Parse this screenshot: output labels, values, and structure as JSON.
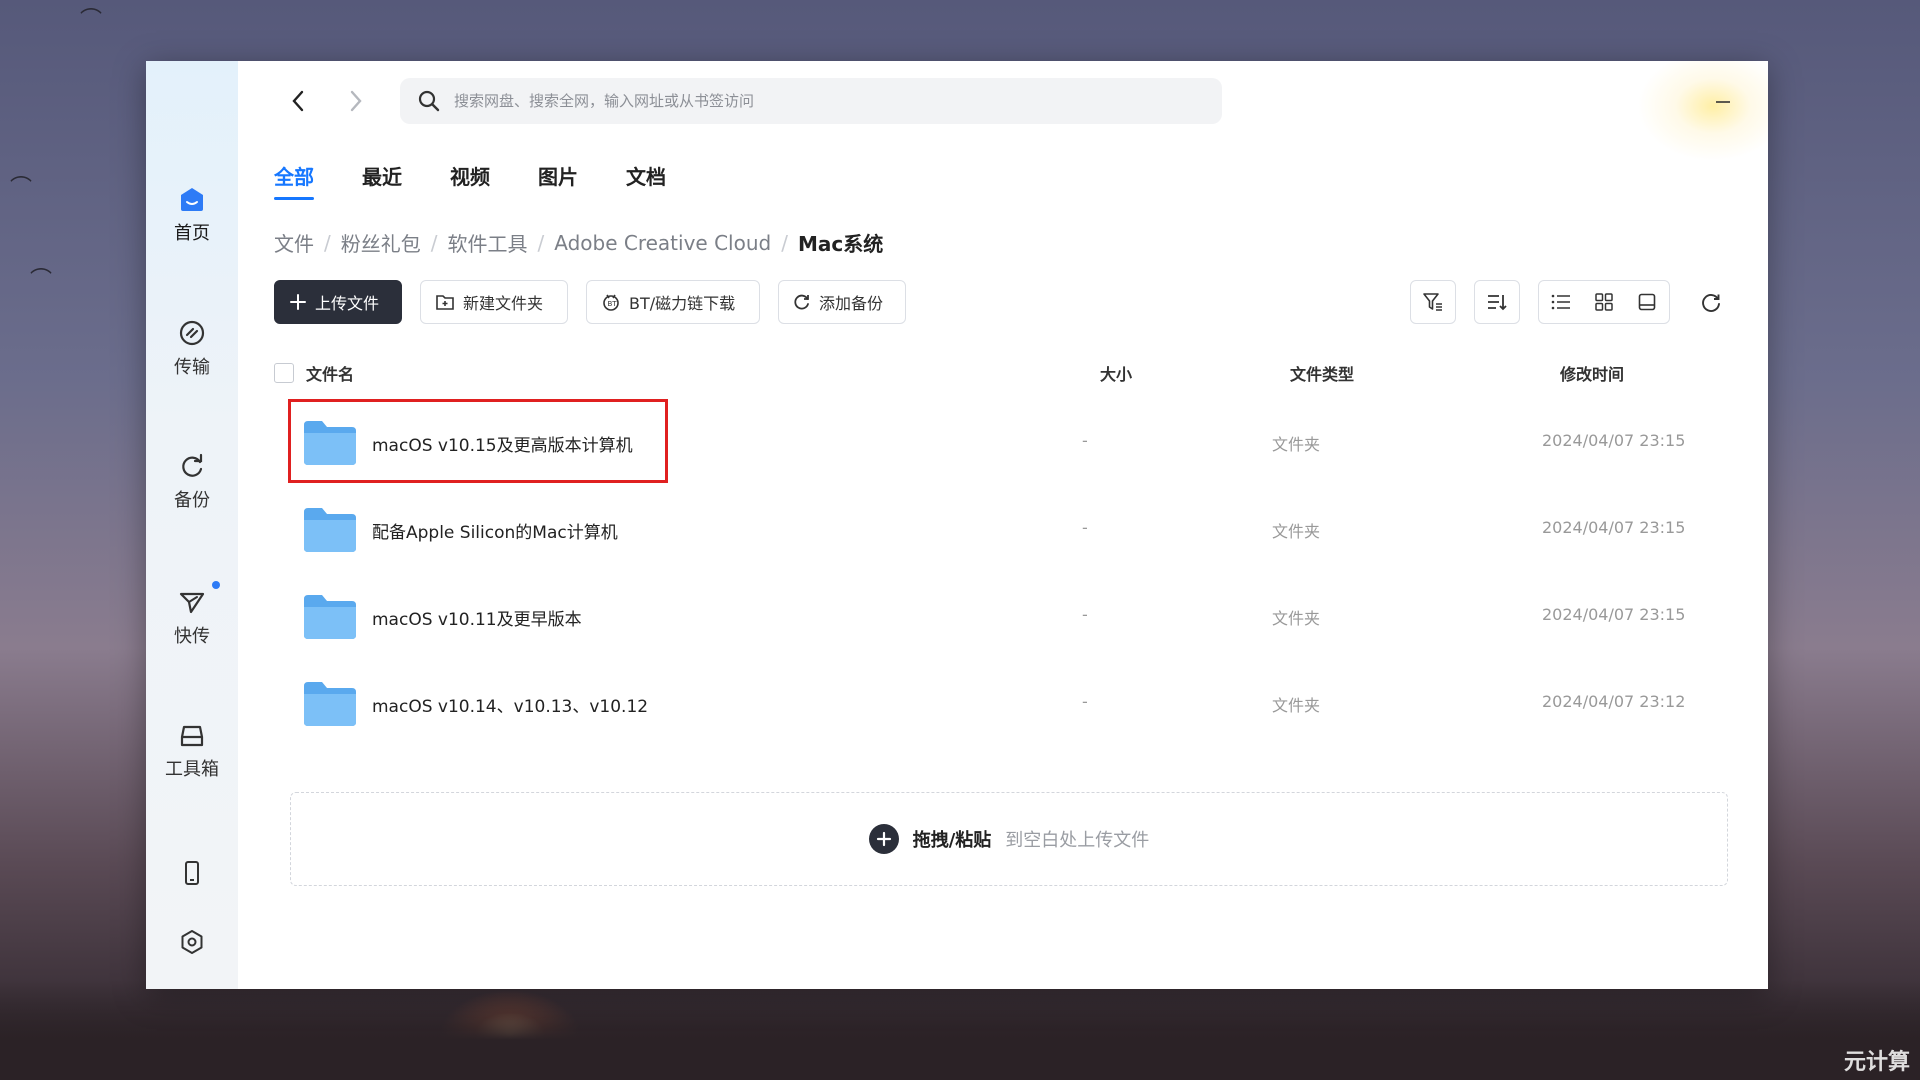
{
  "search": {
    "placeholder": "搜索网盘、搜索全网，输入网址或从书签访问"
  },
  "sidebar": {
    "items": [
      {
        "label": "首页",
        "icon": "home-icon"
      },
      {
        "label": "传输",
        "icon": "transfer-icon"
      },
      {
        "label": "备份",
        "icon": "backup-icon"
      },
      {
        "label": "快传",
        "icon": "send-icon"
      },
      {
        "label": "工具箱",
        "icon": "toolbox-icon"
      }
    ],
    "bottom_icons": [
      "phone-icon",
      "settings-icon"
    ]
  },
  "tabs": [
    {
      "label": "全部",
      "active": true
    },
    {
      "label": "最近"
    },
    {
      "label": "视频"
    },
    {
      "label": "图片"
    },
    {
      "label": "文档"
    }
  ],
  "breadcrumb": [
    "文件",
    "粉丝礼包",
    "软件工具",
    "Adobe Creative Cloud",
    "Mac系统"
  ],
  "toolbar": {
    "upload": "上传文件",
    "new_folder": "新建文件夹",
    "bt_download": "BT/磁力链下载",
    "add_backup": "添加备份"
  },
  "table": {
    "headers": {
      "name": "文件名",
      "size": "大小",
      "type": "文件类型",
      "modified": "修改时间"
    },
    "rows": [
      {
        "name": "macOS v10.15及更高版本计算机",
        "size": "-",
        "type": "文件夹",
        "modified": "2024/04/07 23:15",
        "highlighted": true
      },
      {
        "name": "配备Apple Silicon的Mac计算机",
        "size": "-",
        "type": "文件夹",
        "modified": "2024/04/07 23:15"
      },
      {
        "name": "macOS v10.11及更早版本",
        "size": "-",
        "type": "文件夹",
        "modified": "2024/04/07 23:15"
      },
      {
        "name": "macOS v10.14、v10.13、v10.12",
        "size": "-",
        "type": "文件夹",
        "modified": "2024/04/07 23:12"
      }
    ]
  },
  "dropzone": {
    "action": "拖拽/粘贴",
    "hint": "到空白处上传文件"
  },
  "watermark": "元计算",
  "colors": {
    "accent": "#1677ff",
    "primary_button": "#2b2f3a",
    "highlight_border": "#e02020",
    "folder": "#5aa9ee"
  }
}
